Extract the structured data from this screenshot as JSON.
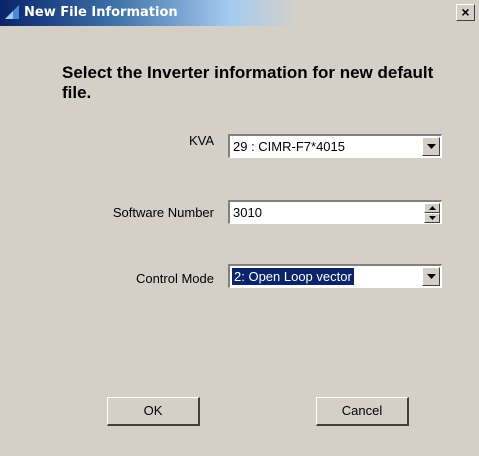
{
  "window": {
    "title": "New File Information",
    "close_symbol": "×"
  },
  "main": {
    "heading": "Select the Inverter information for new default file.",
    "kva": {
      "label": "KVA",
      "value": "29 : CIMR-F7*4015"
    },
    "software": {
      "label": "Software Number",
      "value": "3010"
    },
    "control": {
      "label": "Control Mode",
      "value": "2: Open Loop vector"
    }
  },
  "buttons": {
    "ok": "OK",
    "cancel": "Cancel"
  },
  "icons": [
    "app-icon",
    "close-icon",
    "dropdown-arrow-icon",
    "spin-up-icon",
    "spin-down-icon"
  ],
  "colors": {
    "title_bar": "#0a246a",
    "selection": "#0a246a",
    "dialog_bg": "#d4d0c8"
  }
}
